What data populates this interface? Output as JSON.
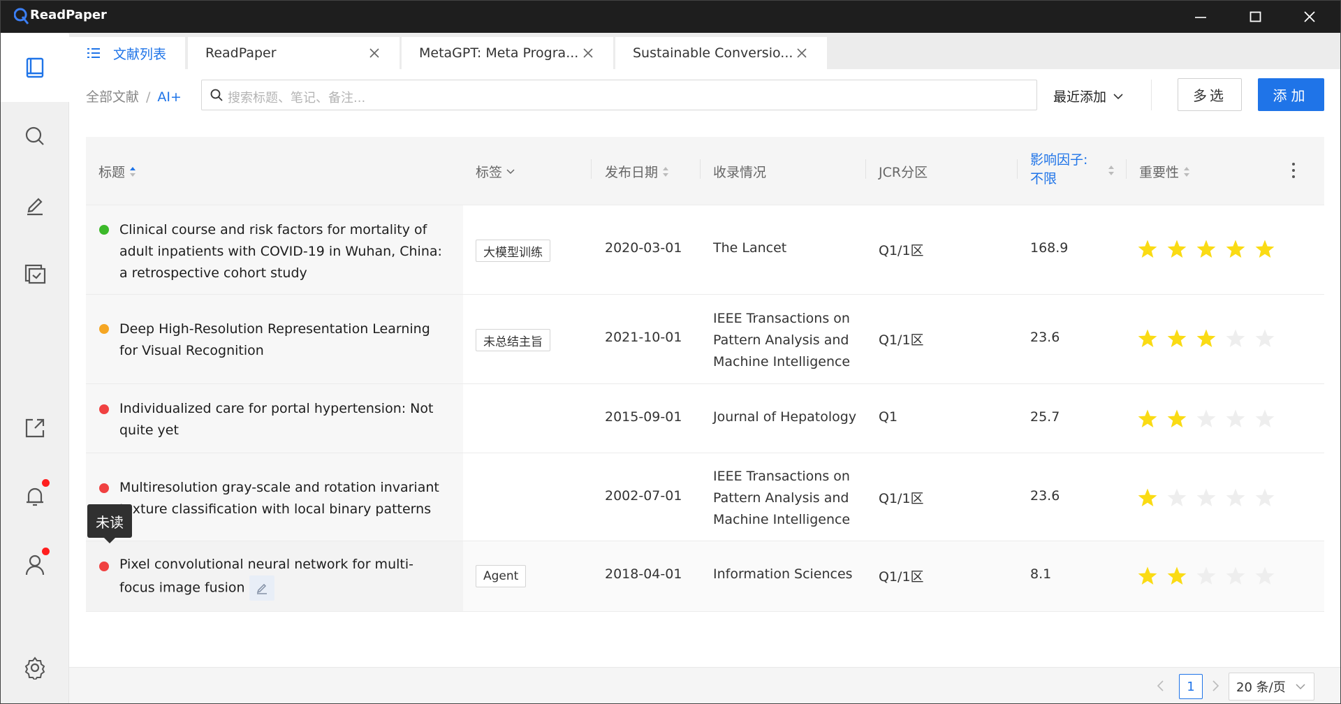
{
  "app": {
    "name": "ReadPaper"
  },
  "tabs": [
    {
      "label": "文献列表",
      "active": true
    },
    {
      "label": "ReadPaper"
    },
    {
      "label": "MetaGPT: Meta Progra..."
    },
    {
      "label": "Sustainable Conversio..."
    }
  ],
  "breadcrumb": {
    "root": "全部文献",
    "sep": "/",
    "current": "AI+"
  },
  "search": {
    "placeholder": "搜索标题、笔记、备注..."
  },
  "toolbar": {
    "sort_label": "最近添加",
    "multi_select": "多选",
    "add": "添加"
  },
  "columns": {
    "title": "标题",
    "tags": "标签",
    "date": "发布日期",
    "indexed": "收录情况",
    "jcr": "JCR分区",
    "impact_line1": "影响因子:",
    "impact_line2": "不限",
    "importance": "重要性"
  },
  "rows": [
    {
      "status": "green",
      "status_color": "#3cb92a",
      "title": "Clinical course and risk factors for mortality of adult inpatients with COVID-19 in Wuhan, China: a retrospective cohort study",
      "tag": "大模型训练",
      "date": "2020-03-01",
      "journal": "The Lancet",
      "jcr": "Q1/1区",
      "impact": "168.9",
      "stars": 5
    },
    {
      "status": "orange",
      "status_color": "#f5a623",
      "title": "Deep High-Resolution Representation Learning for Visual Recognition",
      "tag": "未总结主旨",
      "date": "2021-10-01",
      "journal": "IEEE Transactions on Pattern Analysis and Machine Intelligence",
      "jcr": "Q1/1区",
      "impact": "23.6",
      "stars": 3
    },
    {
      "status": "red",
      "status_color": "#f04141",
      "title": "Individualized care for portal hypertension: Not quite yet",
      "tag": "",
      "date": "2015-09-01",
      "journal": "Journal of Hepatology",
      "jcr": "Q1",
      "impact": "25.7",
      "stars": 2
    },
    {
      "status": "red",
      "status_color": "#f04141",
      "title": "Multiresolution gray-scale and rotation invariant texture classification with local binary patterns",
      "tag": "",
      "date": "2002-07-01",
      "journal": "IEEE Transactions on Pattern Analysis and Machine Intelligence",
      "jcr": "Q1/1区",
      "impact": "23.6",
      "stars": 1
    },
    {
      "status": "red",
      "status_color": "#f04141",
      "title": "Pixel convolutional neural network for multi-focus image fusion",
      "tag": "Agent",
      "date": "2018-04-01",
      "journal": "Information Sciences",
      "jcr": "Q1/1区",
      "impact": "8.1",
      "stars": 2
    }
  ],
  "tooltip": {
    "text": "未读"
  },
  "pagination": {
    "current": "1",
    "page_size": "20 条/页"
  },
  "colors": {
    "accent": "#1f74e8",
    "star_on": "#fadb14",
    "star_off": "#eeeeee",
    "badge": "#ff1e1e"
  },
  "rail_icons": [
    "library-icon",
    "search-icon",
    "edit-icon",
    "inbox-icon",
    "export-icon",
    "bell-icon",
    "user-icon",
    "settings-icon"
  ]
}
